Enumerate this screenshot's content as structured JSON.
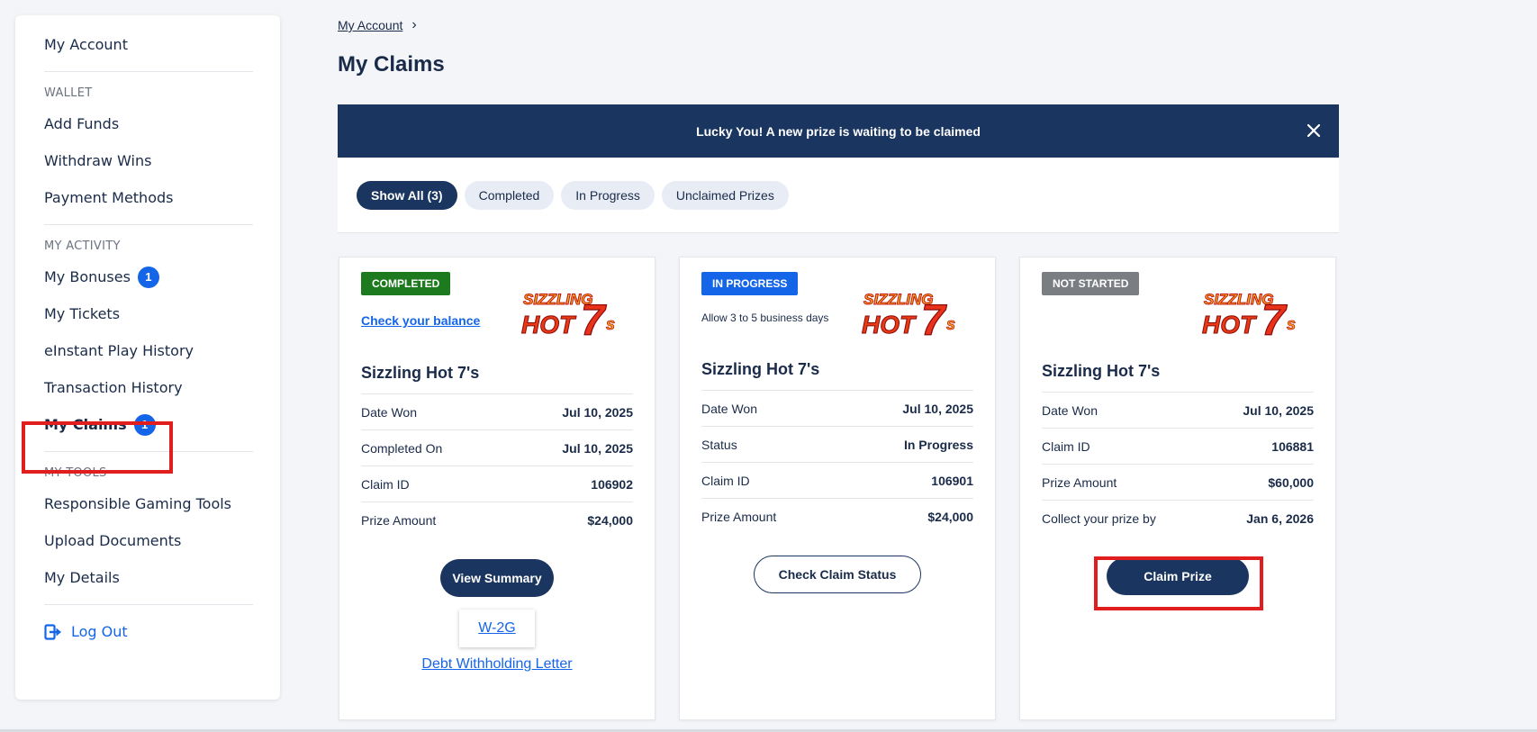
{
  "sidebar": {
    "my_account": "My Account",
    "wallet_header": "WALLET",
    "wallet_items": [
      "Add Funds",
      "Withdraw Wins",
      "Payment Methods"
    ],
    "activity_header": "MY ACTIVITY",
    "my_bonuses": "My Bonuses",
    "my_bonuses_count": "1",
    "my_tickets": "My Tickets",
    "einstant_history": "eInstant Play History",
    "transaction_history": "Transaction History",
    "my_claims": "My Claims",
    "my_claims_count": "1",
    "tools_header": "MY TOOLS",
    "tools_items": [
      "Responsible Gaming Tools",
      "Upload Documents",
      "My Details"
    ],
    "logout": "Log Out"
  },
  "breadcrumb": {
    "link": "My Account"
  },
  "page_title": "My Claims",
  "banner": {
    "text": "Lucky You! A new prize is waiting to be claimed"
  },
  "filters": [
    "Show All (3)",
    "Completed",
    "In Progress",
    "Unclaimed Prizes"
  ],
  "cards": [
    {
      "status": "COMPLETED",
      "status_color": "#1e7a1e",
      "sub_link": "Check your balance",
      "logo_text": "SIZZLING HOT 7's",
      "game": "Sizzling Hot 7's",
      "rows": [
        {
          "k": "Date Won",
          "v": "Jul 10, 2025"
        },
        {
          "k": "Completed On",
          "v": "Jul 10, 2025"
        },
        {
          "k": "Claim ID",
          "v": "106902"
        },
        {
          "k": "Prize Amount",
          "v": "$24,000"
        }
      ],
      "button": "View Summary",
      "w2g": "W-2G",
      "debt_letter": "Debt Withholding Letter"
    },
    {
      "status": "IN PROGRESS",
      "status_color": "#1565e8",
      "sub_note": "Allow 3 to 5 business days",
      "logo_text": "SIZZLING HOT 7's",
      "game": "Sizzling Hot 7's",
      "rows": [
        {
          "k": "Date Won",
          "v": "Jul 10, 2025"
        },
        {
          "k": "Status",
          "v": "In Progress"
        },
        {
          "k": "Claim ID",
          "v": "106901"
        },
        {
          "k": "Prize Amount",
          "v": "$24,000"
        }
      ],
      "button": "Check Claim Status"
    },
    {
      "status": "NOT STARTED",
      "status_color": "#7a7d82",
      "logo_text": "SIZZLING HOT 7's",
      "game": "Sizzling Hot 7's",
      "rows": [
        {
          "k": "Date Won",
          "v": "Jul 10, 2025"
        },
        {
          "k": "Claim ID",
          "v": "106881"
        },
        {
          "k": "Prize Amount",
          "v": "$60,000"
        },
        {
          "k": "Collect your prize by",
          "v": "Jan 6, 2026"
        }
      ],
      "button": "Claim Prize"
    }
  ]
}
